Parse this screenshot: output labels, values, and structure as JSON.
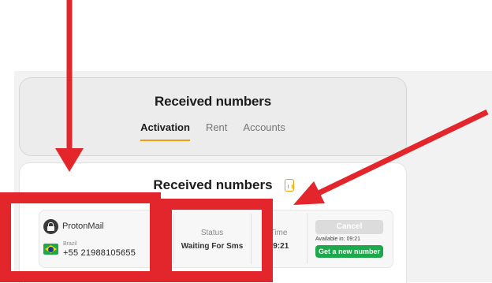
{
  "header": {
    "title": "Received numbers",
    "tabs": [
      {
        "label": "Activation",
        "active": true
      },
      {
        "label": "Rent",
        "active": false
      },
      {
        "label": "Accounts",
        "active": false
      }
    ]
  },
  "main": {
    "title": "Received numbers",
    "row": {
      "service": "ProtonMail",
      "country": "Brazil",
      "phone": "+55 21988105655",
      "status_label": "Status",
      "status_value": "Waiting For Sms",
      "time_label": "Time",
      "time_value": "19:21",
      "cancel_label": "Cancel",
      "available_text": "Available in: 09:21",
      "new_number_label": "Get a new number"
    }
  },
  "colors": {
    "accent": "#f39c12",
    "annotation": "#e3262b",
    "button_green": "#1ea84b",
    "disabled": "#dcdcdc"
  },
  "icons": [
    "lock-icon",
    "brazil-flag-icon",
    "copy-icon",
    "document-icon"
  ]
}
